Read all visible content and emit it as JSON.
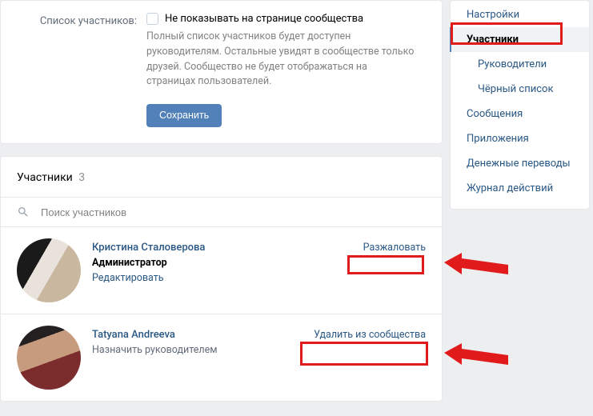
{
  "settings": {
    "row_label": "Список участников:",
    "checkbox_label": "Не показывать на странице сообщества",
    "hint": "Полный список участников будет доступен руководителям. Остальные увидят в сообществе только друзей. Сообщество не будет отображаться на страницах пользователей.",
    "save": "Сохранить"
  },
  "members": {
    "title": "Участники",
    "count": "3",
    "search_placeholder": "Поиск участников",
    "items": [
      {
        "name": "Кристина Сталоверова",
        "role": "Администратор",
        "edit": "Редактировать",
        "right_link": "Разжаловать"
      },
      {
        "name": "Tatyana Andreeva",
        "sub": "Назначить руководителем",
        "right_link": "Удалить из сообщества"
      }
    ]
  },
  "sidebar": {
    "items": [
      "Настройки",
      "Участники",
      "Руководители",
      "Чёрный список",
      "Сообщения",
      "Приложения",
      "Денежные переводы",
      "Журнал действий"
    ]
  }
}
